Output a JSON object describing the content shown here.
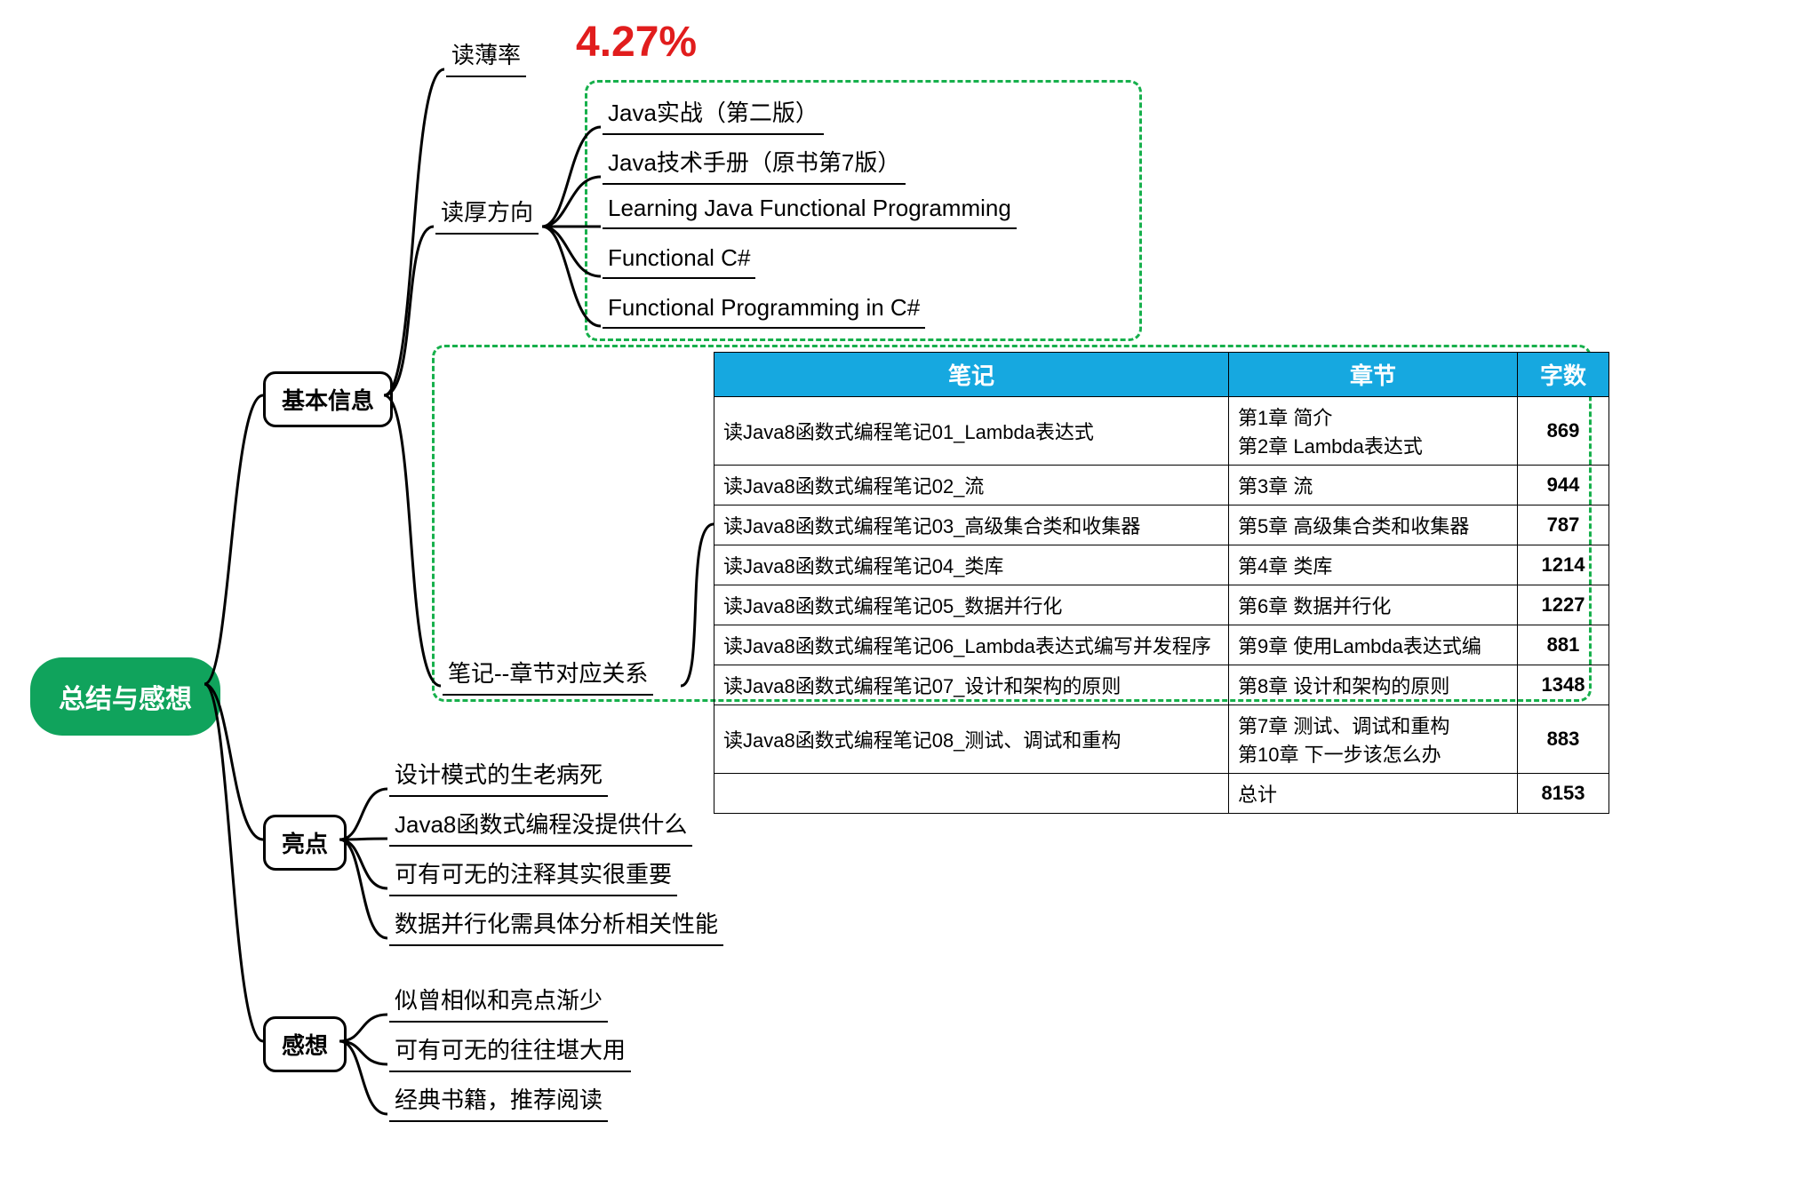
{
  "root": "总结与感想",
  "basic": {
    "title": "基本信息",
    "rate_label": "读薄率",
    "rate_value": "4.27%",
    "thick_label": "读厚方向",
    "thick_items": [
      "Java实战（第二版）",
      "Java技术手册（原书第7版）",
      "Learning Java Functional Programming",
      "Functional C#",
      "Functional Programming in C#"
    ],
    "notes_label": "笔记--章节对应关系"
  },
  "highlights": {
    "title": "亮点",
    "items": [
      "设计模式的生老病死",
      "Java8函数式编程没提供什么",
      "可有可无的注释其实很重要",
      "数据并行化需具体分析相关性能"
    ]
  },
  "thoughts": {
    "title": "感想",
    "items": [
      "似曾相似和亮点渐少",
      "可有可无的往往堪大用",
      "经典书籍，推荐阅读"
    ]
  },
  "table": {
    "headers": [
      "笔记",
      "章节",
      "字数"
    ],
    "rows": [
      {
        "note": "读Java8函数式编程笔记01_Lambda表达式",
        "chapter": "第1章  简介\n第2章  Lambda表达式",
        "count": "869"
      },
      {
        "note": "读Java8函数式编程笔记02_流",
        "chapter": "第3章  流",
        "count": "944"
      },
      {
        "note": "读Java8函数式编程笔记03_高级集合类和收集器",
        "chapter": "第5章  高级集合类和收集器",
        "count": "787"
      },
      {
        "note": "读Java8函数式编程笔记04_类库",
        "chapter": "第4章  类库",
        "count": "1214"
      },
      {
        "note": "读Java8函数式编程笔记05_数据并行化",
        "chapter": "第6章  数据并行化",
        "count": "1227"
      },
      {
        "note": "读Java8函数式编程笔记06_Lambda表达式编写并发程序",
        "chapter": "第9章  使用Lambda表达式编",
        "count": "881"
      },
      {
        "note": "读Java8函数式编程笔记07_设计和架构的原则",
        "chapter": "第8章  设计和架构的原则",
        "count": "1348"
      },
      {
        "note": "读Java8函数式编程笔记08_测试、调试和重构",
        "chapter": "第7章  测试、调试和重构\n第10章  下一步该怎么办",
        "count": "883"
      },
      {
        "note": "",
        "chapter": "总计",
        "count": "8153"
      }
    ]
  }
}
